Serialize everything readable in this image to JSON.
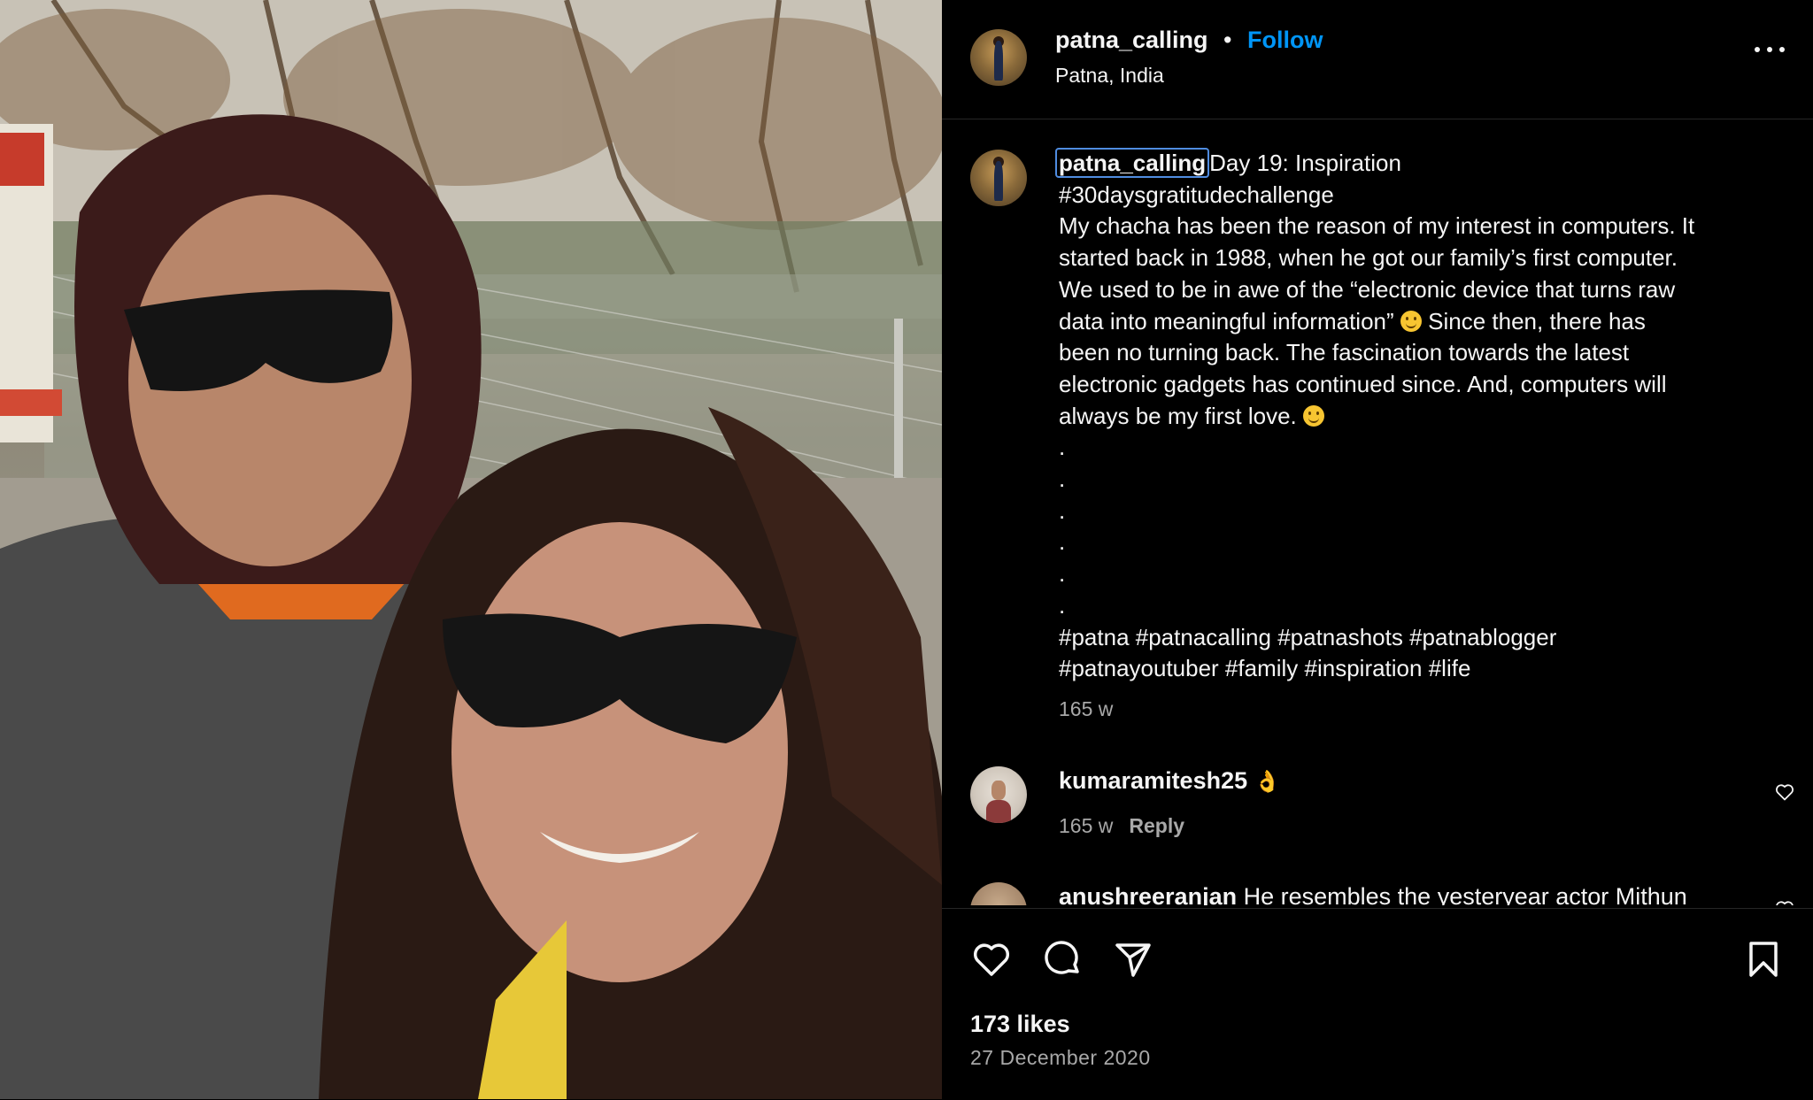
{
  "header": {
    "username": "patna_calling",
    "separator": "•",
    "follow_label": "Follow",
    "location": "Patna, India",
    "more_icon": "more-options-icon"
  },
  "caption": {
    "username": "patna_calling",
    "lines": [
      "Day 19: Inspiration",
      "#30daysgratitudechallenge",
      "My chacha has been the reason of my interest in computers. It",
      "started back in 1988, when he got our family’s first computer.",
      "We used to be in awe of the “electronic device that turns raw",
      "data into meaningful information”",
      "Since then, there has",
      "been no turning back. The fascination towards the latest",
      "electronic gadgets has continued since. And, computers will",
      "always be my first love.",
      ".",
      ".",
      ".",
      ".",
      ".",
      ".",
      "#patna #patnacalling #patnashots #patnablogger",
      "#patnayoutuber #family #inspiration #life"
    ],
    "timestamp": "165 w"
  },
  "comments": [
    {
      "username": "kumaramitesh25",
      "emoji": "👌",
      "age": "165 w",
      "reply_label": "Reply"
    },
    {
      "username": "anushreeranjan",
      "text": "He resembles the yesteryear actor Mithun"
    }
  ],
  "actions": {
    "likes": "173 likes",
    "date": "27 December 2020"
  },
  "colors": {
    "background": "#000000",
    "text": "#f5f5f5",
    "secondary_text": "#a8a8a8",
    "accent": "#0095f6",
    "divider": "#262626"
  }
}
